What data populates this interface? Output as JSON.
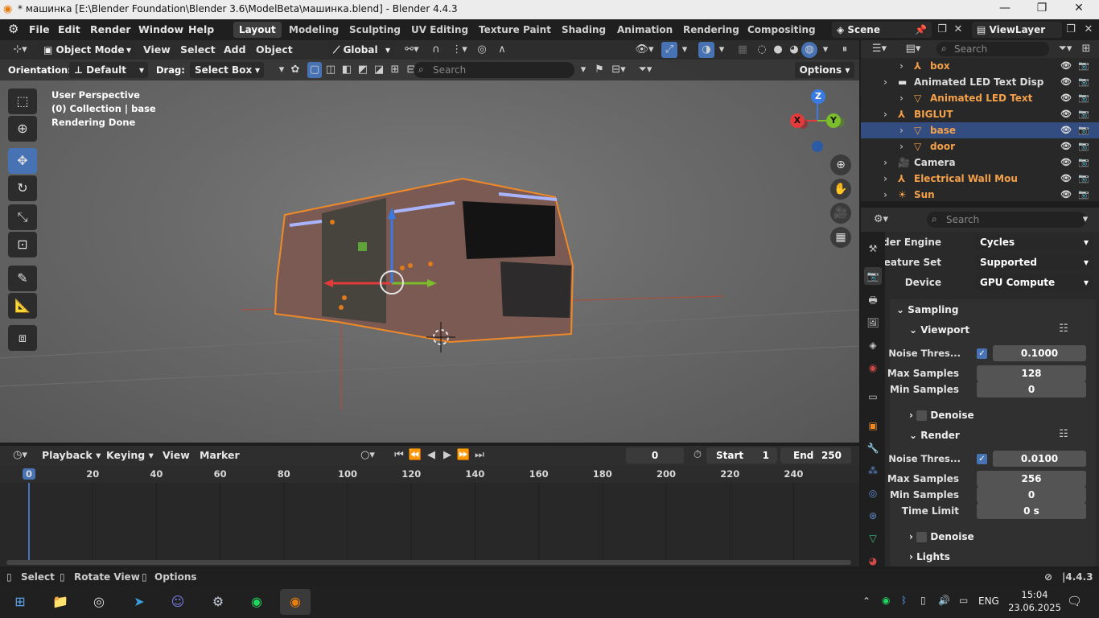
{
  "window": {
    "title": "* машинка [E:\\Blender Foundation\\Blender 3.6\\ModelBeta\\машинка.blend] - Blender 4.4.3"
  },
  "topmenu": [
    "File",
    "Edit",
    "Render",
    "Window",
    "Help"
  ],
  "workspaces": [
    "Layout",
    "Modeling",
    "Sculpting",
    "UV Editing",
    "Texture Paint",
    "Shading",
    "Animation",
    "Rendering",
    "Compositing"
  ],
  "scene": {
    "scene_name": "Scene",
    "viewlayer": "ViewLayer"
  },
  "viewport": {
    "mode": "Object Mode",
    "menus": [
      "View",
      "Select",
      "Add",
      "Object"
    ],
    "transform": "Global",
    "orientation_label": "Orientation:",
    "orientation_value": "Default",
    "drag_label": "Drag:",
    "drag_value": "Select Box",
    "search_placeholder": "Search",
    "options": "Options",
    "info_lines": [
      "User Perspective",
      "(0) Collection | base",
      "Rendering Done"
    ],
    "gizmo": {
      "x": "X",
      "y": "Y",
      "z": "Z"
    }
  },
  "outliner": {
    "search_placeholder": "Search",
    "rows": [
      {
        "label": "box",
        "indent": 2,
        "color": "orange",
        "type": "empty"
      },
      {
        "label": "Animated LED Text Disp",
        "indent": 1,
        "color": "white",
        "type": "collection"
      },
      {
        "label": "Animated LED Text",
        "indent": 2,
        "color": "orange",
        "type": "mesh"
      },
      {
        "label": "BIGLUT",
        "indent": 1,
        "color": "orange",
        "type": "empty"
      },
      {
        "label": "base",
        "indent": 2,
        "color": "orange",
        "type": "mesh",
        "selected": true
      },
      {
        "label": "door",
        "indent": 2,
        "color": "orange",
        "type": "mesh"
      },
      {
        "label": "Camera",
        "indent": 1,
        "color": "white",
        "type": "camera"
      },
      {
        "label": "Electrical Wall Mou",
        "indent": 1,
        "color": "orange",
        "type": "empty"
      },
      {
        "label": "Sun",
        "indent": 1,
        "color": "orange",
        "type": "light"
      }
    ]
  },
  "properties": {
    "search_placeholder": "Search",
    "render_engine": {
      "label": "Render Engine",
      "value": "Cycles"
    },
    "feature_set": {
      "label": "Feature Set",
      "value": "Supported"
    },
    "device": {
      "label": "Device",
      "value": "GPU Compute"
    },
    "sampling": "Sampling",
    "viewport_panel": "Viewport",
    "viewport_noise": {
      "label": "Noise Thres...",
      "value": "0.1000"
    },
    "viewport_max": {
      "label": "Max Samples",
      "value": "128"
    },
    "viewport_min": {
      "label": "Min Samples",
      "value": "0"
    },
    "denoise": "Denoise",
    "render_panel": "Render",
    "render_noise": {
      "label": "Noise Thres...",
      "value": "0.0100"
    },
    "render_max": {
      "label": "Max Samples",
      "value": "256"
    },
    "render_min": {
      "label": "Min Samples",
      "value": "0"
    },
    "time_limit": {
      "label": "Time Limit",
      "value": "0 s"
    },
    "denoise2": "Denoise",
    "lights": "Lights"
  },
  "timeline": {
    "menus": [
      "Playback",
      "Keying",
      "View",
      "Marker"
    ],
    "current_frame": "0",
    "start_label": "Start",
    "start": "1",
    "end_label": "End",
    "end": "250",
    "ticks": [
      "0",
      "20",
      "40",
      "60",
      "80",
      "100",
      "120",
      "140",
      "160",
      "180",
      "200",
      "220",
      "240"
    ]
  },
  "statusbar": {
    "select": "Select",
    "rotate": "Rotate View",
    "options": "Options",
    "version": "4.4.3"
  },
  "taskbar": {
    "lang": "ENG",
    "time": "15:04",
    "date": "23.06.2025"
  }
}
